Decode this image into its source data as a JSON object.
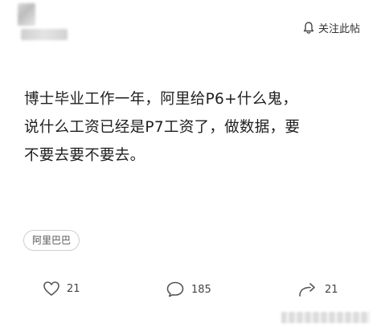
{
  "header": {
    "follow_label": "关注此帖"
  },
  "post": {
    "text": "博士毕业工作一年，阿里给P6+什么鬼，\n说什么工资已经是P7工资了，做数据，要\n不要去要不要去。"
  },
  "tag": {
    "label": "阿里巴巴"
  },
  "actions": {
    "likes": "21",
    "comments": "185",
    "shares": "21"
  },
  "icons": {
    "follow": "bell-icon",
    "like": "heart-icon",
    "comment": "comment-bubble-icon",
    "share": "share-arrow-icon"
  },
  "colors": {
    "text": "#1e1e1e",
    "icon": "#555555",
    "tag_border": "#cfcfcf"
  }
}
